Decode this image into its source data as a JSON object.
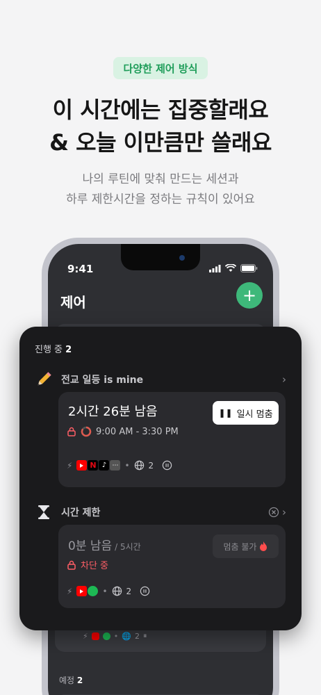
{
  "promo": {
    "badge": "다양한 제어 방식",
    "headline_1": "이 시간에는 집중할래요",
    "headline_2": "& 오늘 이만큼만 쓸래요",
    "sub_1": "나의 루틴에 맞춰 만드는 세션과",
    "sub_2": "하루 제한시간을 정하는 규칙이 있어요"
  },
  "status_bar": {
    "time": "9:41"
  },
  "app": {
    "title": "제어",
    "add_icon": "plus-icon",
    "bg_meta_count": "2",
    "scheduled_label": "예정",
    "scheduled_count": "2"
  },
  "panel": {
    "in_progress_label": "진행 중",
    "in_progress_count": "2",
    "session": {
      "icon": "pencil-emoji",
      "title": "전교 일등 is mine",
      "remaining": "2시간 26분 남음",
      "pause_label": "일시 멈춤",
      "schedule": "9:00 AM - 3:30 PM",
      "web_count": "2"
    },
    "limit": {
      "icon": "hourglass-icon",
      "title": "시간 제한",
      "remaining": "0분 남음",
      "limit_total": "/ 5시간",
      "status": "차단 중",
      "pause_label": "멈춤 불가",
      "web_count": "2"
    }
  },
  "colors": {
    "accent": "#3eb87a",
    "danger": "#ff5e66",
    "panel": "#1a1a1c"
  }
}
